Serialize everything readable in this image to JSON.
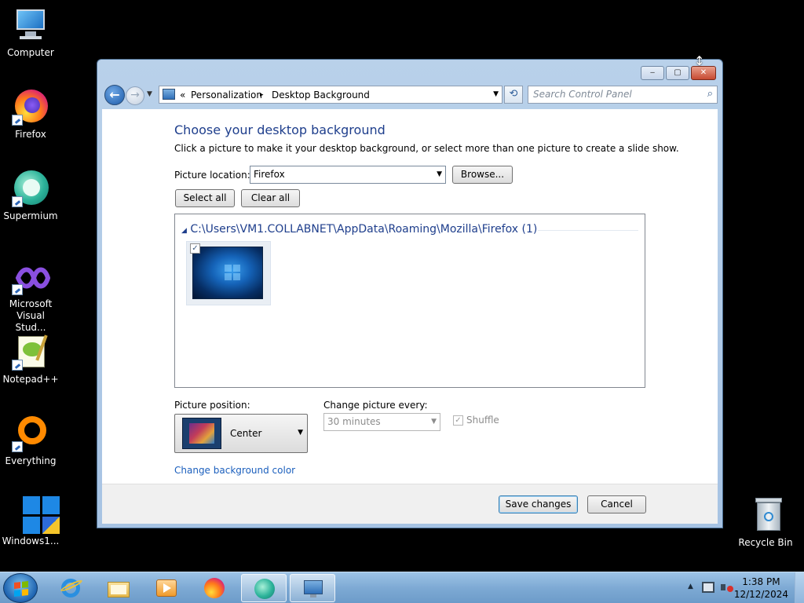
{
  "desktop": {
    "icons": [
      {
        "label": "Computer",
        "icon": "computer-icon"
      },
      {
        "label": "Firefox",
        "icon": "firefox-icon"
      },
      {
        "label": "Supermium",
        "icon": "supermium-icon"
      },
      {
        "label": "Microsoft Visual Stud...",
        "icon": "visual-studio-icon"
      },
      {
        "label": "Notepad++",
        "icon": "notepad-plus-plus-icon"
      },
      {
        "label": "Everything",
        "icon": "everything-icon"
      },
      {
        "label": "Windows1...",
        "icon": "windows-shield-icon"
      },
      {
        "label": "Recycle Bin",
        "icon": "recycle-bin-icon"
      }
    ]
  },
  "window": {
    "caption_buttons": {
      "minimize": "‒",
      "maximize": "▢",
      "close": "✕"
    },
    "nav": {
      "back": "←",
      "forward": "→",
      "overflow": "«",
      "breadcrumb": [
        "Personalization",
        "Desktop Background"
      ],
      "separator": "▸",
      "search_placeholder": "Search Control Panel"
    },
    "title": "Choose your desktop background",
    "description": "Click a picture to make it your desktop background, or select more than one picture to create a slide show.",
    "picture_location": {
      "label": "Picture location:",
      "value": "Firefox"
    },
    "browse_button": "Browse...",
    "select_all_button": "Select all",
    "clear_all_button": "Clear all",
    "picture_group": {
      "path": "C:\\Users\\VM1.COLLABNET\\AppData\\Roaming\\Mozilla\\Firefox (1)",
      "items": [
        {
          "checked": true,
          "checkmark": "✓"
        }
      ]
    },
    "picture_position": {
      "label": "Picture position:",
      "value": "Center"
    },
    "change_every": {
      "label": "Change picture every:",
      "value": "30 minutes",
      "enabled": false
    },
    "shuffle": {
      "label": "Shuffle",
      "checked": true,
      "enabled": false,
      "checkmark": "✓"
    },
    "background_color_link": "Change background color",
    "save_button": "Save changes",
    "cancel_button": "Cancel"
  },
  "taskbar": {
    "apps": [
      "internet-explorer-icon",
      "file-explorer-icon",
      "media-player-icon",
      "firefox-icon",
      "supermium-icon",
      "control-panel-icon"
    ],
    "tray_expand": "▲",
    "clock": {
      "time": "1:38 PM",
      "date": "12/12/2024"
    }
  },
  "colors": {
    "accent_heading": "#1e3e8c",
    "link": "#1b5fbd",
    "window_frame": "#b9d1ea",
    "taskbar": "#7eaad4"
  }
}
